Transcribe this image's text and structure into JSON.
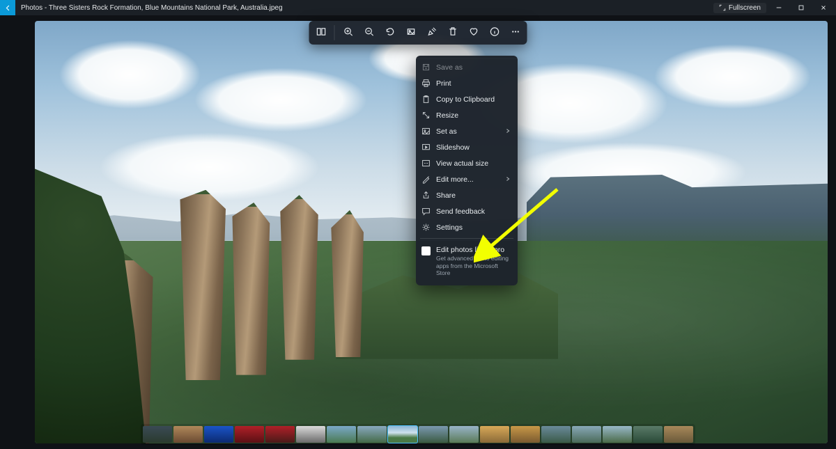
{
  "titlebar": {
    "app_and_file": "Photos - Three Sisters Rock Formation, Blue Mountains National Park, Australia.jpeg",
    "fullscreen_label": "Fullscreen"
  },
  "toolbar": {
    "buttons": [
      "compare",
      "zoom-in",
      "zoom-out",
      "rotate",
      "crop",
      "markup",
      "delete",
      "favorite",
      "info",
      "more"
    ]
  },
  "menu": {
    "items": [
      {
        "icon": "save-icon",
        "label": "Save as",
        "cutoff": true
      },
      {
        "icon": "print-icon",
        "label": "Print"
      },
      {
        "icon": "clipboard-icon",
        "label": "Copy to Clipboard"
      },
      {
        "icon": "resize-icon",
        "label": "Resize"
      },
      {
        "icon": "image-icon",
        "label": "Set as",
        "submenu": true
      },
      {
        "icon": "slideshow-icon",
        "label": "Slideshow"
      },
      {
        "icon": "actualsize-icon",
        "label": "View actual size"
      },
      {
        "icon": "editmore-icon",
        "label": "Edit more...",
        "submenu": true
      },
      {
        "icon": "share-icon",
        "label": "Share"
      },
      {
        "icon": "feedback-icon",
        "label": "Send feedback"
      },
      {
        "icon": "settings-icon",
        "label": "Settings"
      }
    ],
    "promo": {
      "title": "Edit photos like a pro",
      "subtitle": "Get advanced photo editing apps from the Microsoft Store"
    }
  },
  "filmstrip": {
    "count": 18,
    "selected_index": 8,
    "thumb_styles": [
      "linear-gradient(#3a4a55,#2a3a2e)",
      "linear-gradient(#b0885a,#6a4a32)",
      "linear-gradient(#1a54c8,#0c2a70)",
      "linear-gradient(#b02028,#5a1014)",
      "linear-gradient(#b02028,#4a1a18)",
      "linear-gradient(#dadada,#6a6a6a)",
      "linear-gradient(#7aa8c8,#4a7a52)",
      "linear-gradient(#88a8c0,#446a48)",
      "linear-gradient(#8cb4d4 0%,#cfe2ee 40%,#4a7a46 70%)",
      "linear-gradient(#7a98b0,#3a5a42)",
      "linear-gradient(#98b4c8,#5a7a58)",
      "linear-gradient(#d8a858,#8a6a38)",
      "linear-gradient(#c89848,#7a5a30)",
      "linear-gradient(#6a8a9a,#3a5a48)",
      "linear-gradient(#88a8b8,#4a6a58)",
      "linear-gradient(#98b8c8,#4a6a48)",
      "linear-gradient(#5a7a68,#2a4a38)",
      "linear-gradient(#a8885a,#6a5a3a)"
    ]
  }
}
